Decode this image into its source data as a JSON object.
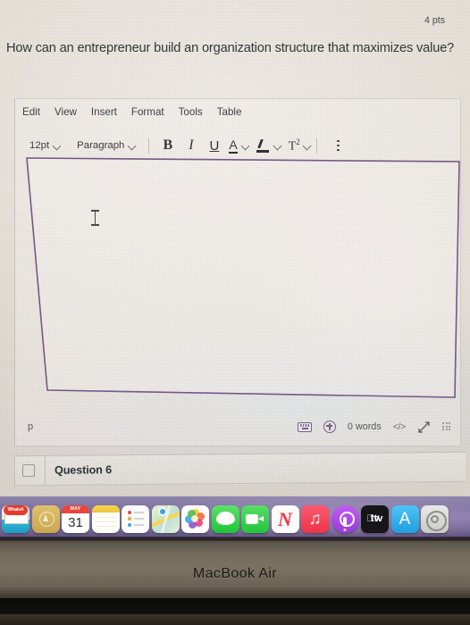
{
  "question": {
    "text": "How can an entrepreneur build an organization structure that maximizes value?"
  },
  "editor": {
    "menubar": [
      {
        "label": "Edit"
      },
      {
        "label": "View"
      },
      {
        "label": "Insert"
      },
      {
        "label": "Format"
      },
      {
        "label": "Tools"
      },
      {
        "label": "Table"
      }
    ],
    "toolbar": {
      "font_size": "12pt",
      "block_format": "Paragraph",
      "bold": "B",
      "italic": "I",
      "underline": "U",
      "text_color": "A",
      "highlight": "highlight-icon",
      "superscript": "T",
      "superscript_exp": "2",
      "more": "more-options-icon"
    },
    "body_text": "",
    "statusbar": {
      "element_path": "p",
      "keyboard_icon": "keyboard-shortcuts-icon",
      "a11y_icon": "accessibility-checker-icon",
      "word_count": "0 words",
      "html_editor": "</>",
      "fullscreen_icon": "expand-arrows-icon",
      "resize_grip": "resize-grip-icon"
    }
  },
  "question_bar": {
    "flag": "flag-icon",
    "title": "Question 6",
    "points": "4 pts"
  },
  "dock": {
    "items": [
      {
        "name": "mail",
        "badge": "WhatsA"
      },
      {
        "name": "unknown-gold"
      },
      {
        "name": "calendar",
        "month": "MAY",
        "day": "31"
      },
      {
        "name": "notes"
      },
      {
        "name": "reminders"
      },
      {
        "name": "maps"
      },
      {
        "name": "photos"
      },
      {
        "name": "messages"
      },
      {
        "name": "facetime"
      },
      {
        "name": "news"
      },
      {
        "name": "music"
      },
      {
        "name": "podcasts"
      },
      {
        "name": "appletv",
        "label": "tv"
      },
      {
        "name": "appstore"
      },
      {
        "name": "settings"
      }
    ]
  },
  "device": {
    "model": "MacBook Air"
  },
  "colors": {
    "editor_border": "#7b5a8a",
    "dock_bg": "#8b7bab",
    "question_bar_text": "#2f333a",
    "accent_purple": "#7d5f8e"
  }
}
